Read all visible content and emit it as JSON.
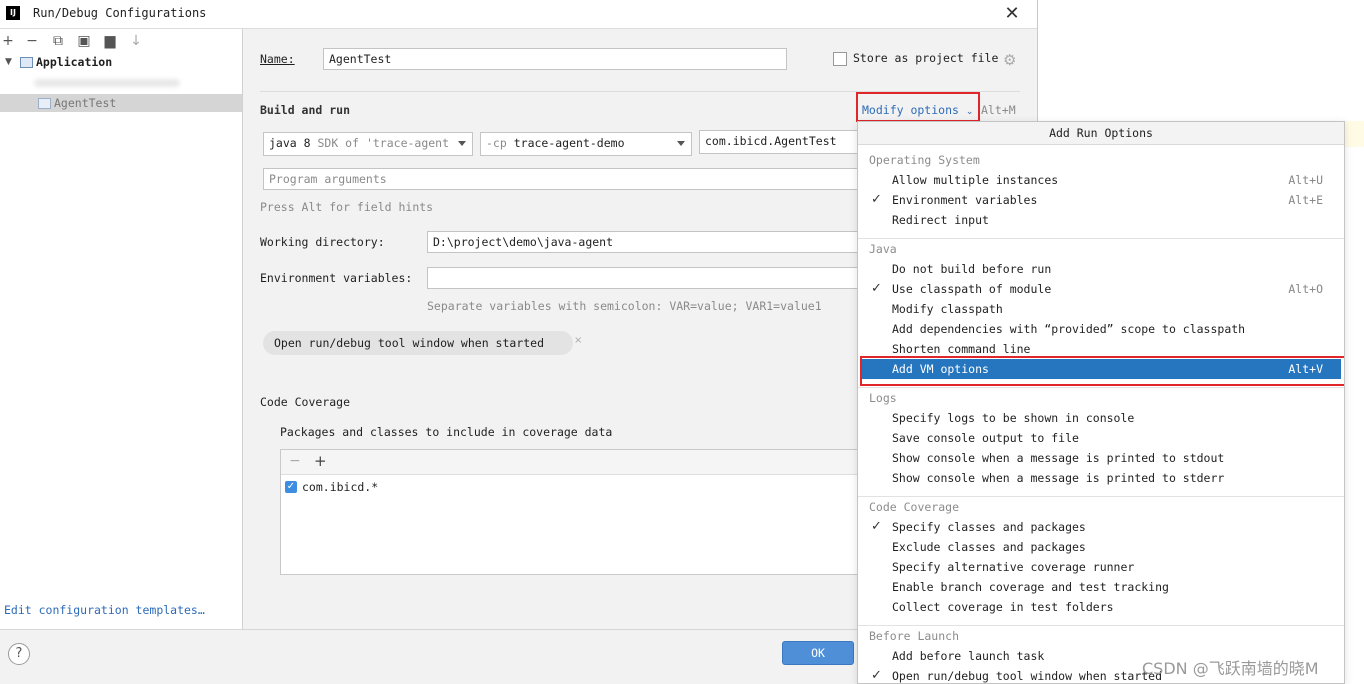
{
  "window": {
    "title": "Run/Debug Configurations",
    "logo": "IJ",
    "close": "✕"
  },
  "left": {
    "toolbar": [
      "+",
      "−",
      "⧉",
      "▣",
      "▆",
      "↓"
    ],
    "tree": {
      "root": "Application",
      "selected": "AgentTest"
    },
    "edit_templates": "Edit configuration templates…"
  },
  "form": {
    "name_label": "Name:",
    "name_value": "AgentTest",
    "store_label": "Store as project file",
    "section_build": "Build and run",
    "modify_options": "Modify options",
    "modify_shortcut": "Alt+M",
    "jdk_main": "java 8",
    "jdk_hint": "SDK of 'trace-agent",
    "cp_hint": "-cp",
    "cp_value": "trace-agent-demo",
    "main_class": "com.ibicd.AgentTest",
    "program_args_placeholder": "Program arguments",
    "alt_hint": "Press Alt for field hints",
    "workdir_label": "Working directory:",
    "workdir_value": "D:\\project\\demo\\java-agent",
    "env_label": "Environment variables:",
    "env_hint": "Separate variables with semicolon: VAR=value; VAR1=value1",
    "open_tool_chip": "Open run/debug tool window when started",
    "coverage_title": "Code Coverage",
    "coverage_sub": "Packages and classes to include in coverage data",
    "coverage_item": "com.ibicd.*",
    "ok": "OK"
  },
  "popup": {
    "title": "Add Run Options",
    "groups": {
      "os": "Operating System",
      "java": "Java",
      "logs": "Logs",
      "coverage": "Code Coverage",
      "before": "Before Launch"
    },
    "os": [
      {
        "label": "Allow multiple instances",
        "shortcut": "Alt+U"
      },
      {
        "label": "Environment variables",
        "shortcut": "Alt+E"
      },
      {
        "label": "Redirect input",
        "shortcut": ""
      }
    ],
    "java": [
      {
        "label": "Do not build before run",
        "shortcut": ""
      },
      {
        "label": "Use classpath of module",
        "shortcut": "Alt+O"
      },
      {
        "label": "Modify classpath",
        "shortcut": ""
      },
      {
        "label": "Add dependencies with “provided” scope to classpath",
        "shortcut": ""
      },
      {
        "label": "Shorten command line",
        "shortcut": ""
      },
      {
        "label": "Add VM options",
        "shortcut": "Alt+V"
      }
    ],
    "logs": [
      {
        "label": "Specify logs to be shown in console"
      },
      {
        "label": "Save console output to file"
      },
      {
        "label": "Show console when a message is printed to stdout"
      },
      {
        "label": "Show console when a message is printed to stderr"
      }
    ],
    "coverage": [
      {
        "label": "Specify classes and packages"
      },
      {
        "label": "Exclude classes and packages"
      },
      {
        "label": "Specify alternative coverage runner"
      },
      {
        "label": "Enable branch coverage and test tracking"
      },
      {
        "label": "Collect coverage in test folders"
      }
    ],
    "before": [
      {
        "label": "Add before launch task"
      },
      {
        "label": "Open run/debug tool window when started"
      }
    ],
    "check": "✓"
  },
  "watermark": "CSDN @飞跃南墙的晓M",
  "colors": {
    "accent": "#2675bf",
    "highlight_box": "#e0252b",
    "link": "#2d6bb8"
  }
}
